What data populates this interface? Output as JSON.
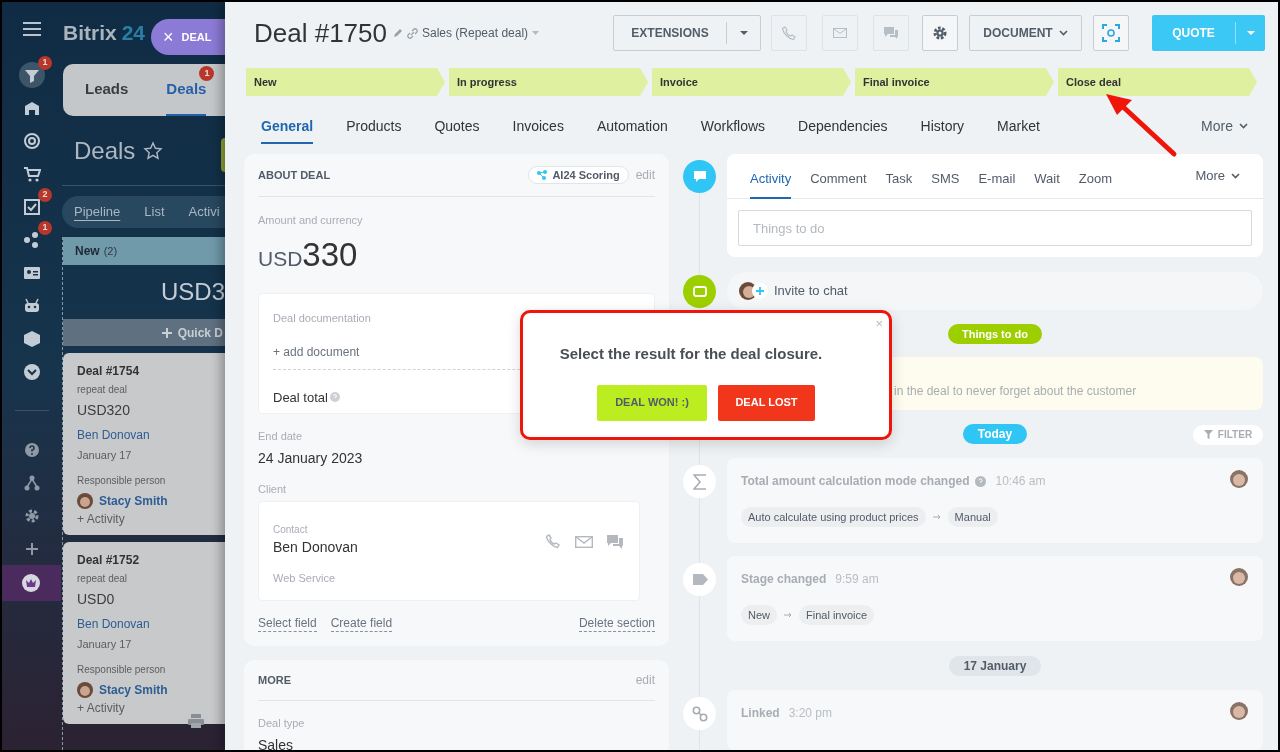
{
  "app": {
    "logo_text": "Bitrix",
    "logo_number": "24",
    "close_tab": {
      "icon": "×",
      "label": "DEAL"
    }
  },
  "sidebar": {
    "top": [
      {
        "kind": "funnel",
        "selected": true,
        "badge": "1"
      },
      {
        "kind": "store",
        "selected": false
      },
      {
        "kind": "target",
        "selected": false
      },
      {
        "kind": "cart",
        "selected": false
      },
      {
        "kind": "tasks",
        "selected": false,
        "badge": "2"
      },
      {
        "kind": "network",
        "selected": false,
        "badge": "1"
      },
      {
        "kind": "contact",
        "selected": false
      },
      {
        "kind": "robot",
        "selected": false
      },
      {
        "kind": "box",
        "selected": false
      },
      {
        "kind": "more",
        "selected": false
      }
    ],
    "bottom": [
      {
        "kind": "help",
        "selected": false
      },
      {
        "kind": "sitemap",
        "selected": false
      },
      {
        "kind": "settings",
        "selected": false
      },
      {
        "kind": "add",
        "selected": false
      },
      {
        "kind": "crown",
        "selected": true
      }
    ]
  },
  "background": {
    "tabs": [
      {
        "label": "Leads",
        "selected": false
      },
      {
        "label": "Deals",
        "selected": true,
        "badge": "1"
      }
    ],
    "title": "Deals",
    "views": [
      {
        "label": "Pipeline",
        "selected": true
      },
      {
        "label": "List",
        "selected": false
      },
      {
        "label": "Activi",
        "selected": false
      }
    ],
    "column": {
      "name": "New",
      "count": "(2)",
      "sum": "USD3",
      "quick": "Quick D"
    },
    "cards": [
      {
        "title": "Deal #1754",
        "subtitle": "repeat deal",
        "amount": "USD320",
        "client": "Ben Donovan",
        "date": "January 17",
        "person_label": "Responsible person",
        "person": "Stacy Smith",
        "activity": "+ Activity"
      },
      {
        "title": "Deal #1752",
        "subtitle": "repeat deal",
        "amount": "USD0",
        "client": "Ben Donovan",
        "date": "January 17",
        "person_label": "Responsible person",
        "person": "Stacy Smith",
        "activity": "+ Activity"
      }
    ]
  },
  "deal": {
    "title": "Deal #1750",
    "pipeline": "Sales (Repeat deal)"
  },
  "toolbar": {
    "extensions": "EXTENSIONS",
    "document": "DOCUMENT",
    "quote": "QUOTE"
  },
  "stages": [
    {
      "label": "New"
    },
    {
      "label": "In progress"
    },
    {
      "label": "Invoice"
    },
    {
      "label": "Final invoice"
    },
    {
      "label": "Close deal"
    }
  ],
  "tabs": [
    {
      "label": "General",
      "selected": true
    },
    {
      "label": "Products",
      "selected": false
    },
    {
      "label": "Quotes",
      "selected": false
    },
    {
      "label": "Invoices",
      "selected": false
    },
    {
      "label": "Automation",
      "selected": false
    },
    {
      "label": "Workflows",
      "selected": false
    },
    {
      "label": "Dependencies",
      "selected": false
    },
    {
      "label": "History",
      "selected": false
    },
    {
      "label": "Market",
      "selected": false
    }
  ],
  "tabs_more": "More",
  "about": {
    "title": "ABOUT DEAL",
    "badge": "AI24 Scoring",
    "edit": "edit",
    "amount_label": "Amount and currency",
    "currency": "USD",
    "amount": "330",
    "doc_label": "Deal documentation",
    "add_doc": "+ add document",
    "total_label": "Deal total",
    "end_date_label": "End date",
    "end_date": "24 January 2023",
    "client_label": "Client",
    "contact_label": "Contact",
    "contact_name": "Ben Donovan",
    "company": "Web Service",
    "actions": [
      "Select field",
      "Create field"
    ],
    "delete": "Delete section"
  },
  "more": {
    "title": "MORE",
    "edit": "edit",
    "type_label": "Deal type",
    "type": "Sales"
  },
  "timeline": {
    "composer_tabs": [
      {
        "label": "Activity",
        "selected": true
      },
      {
        "label": "Comment",
        "selected": false
      },
      {
        "label": "Task",
        "selected": false
      },
      {
        "label": "SMS",
        "selected": false
      },
      {
        "label": "E-mail",
        "selected": false
      },
      {
        "label": "Wait",
        "selected": false
      },
      {
        "label": "Zoom",
        "selected": false
      }
    ],
    "composer_more": "More",
    "placeholder": "Things to do",
    "invite": "Invite to chat",
    "todo_badge": "Things to do",
    "todo_text": "in the deal to never forget about the customer",
    "filter": "FILTER",
    "groups": [
      {
        "date": "Today",
        "kind": "today",
        "events": [
          {
            "kind": "sum",
            "title": "Total amount calculation mode changed",
            "help": true,
            "time": "10:46 am",
            "from": "Auto calculate using product prices",
            "to": "Manual"
          },
          {
            "kind": "stage",
            "title": "Stage changed",
            "help": false,
            "time": "9:59 am",
            "from": "New",
            "to": "Final invoice"
          }
        ]
      },
      {
        "date": "17 January",
        "kind": "past",
        "events": [
          {
            "kind": "link",
            "title": "Linked",
            "help": false,
            "time": "3:20 pm"
          }
        ]
      }
    ]
  },
  "modal": {
    "close": "×",
    "message": "Select the result for the deal closure.",
    "won": "DEAL WON! :)",
    "lost": "DEAL LOST"
  }
}
